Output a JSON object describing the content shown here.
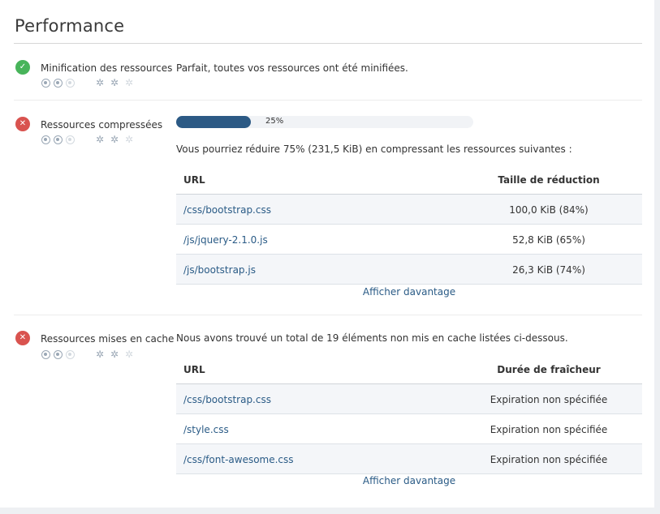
{
  "title": "Performance",
  "colors": {
    "ok": "#48b45a",
    "bad": "#d9534f",
    "progress": "#2c5a85",
    "link": "#2a5b86"
  },
  "rules": [
    {
      "name": "Minification des ressources",
      "status": "ok",
      "status_icon": "check-icon",
      "description": "Parfait, toutes vos ressources ont été minifiées."
    },
    {
      "name": "Ressources compressées",
      "status": "bad",
      "status_icon": "cross-icon",
      "progress": {
        "percent": 25,
        "label": "25%"
      },
      "description": "Vous pourriez réduire 75% (231,5 KiB) en compressant les ressources suivantes :",
      "table": {
        "col_url": "URL",
        "col_value": "Taille de réduction",
        "rows": [
          {
            "url": "/css/bootstrap.css",
            "value": "100,0 KiB (84%)"
          },
          {
            "url": "/js/jquery-2.1.0.js",
            "value": "52,8 KiB (65%)"
          },
          {
            "url": "/js/bootstrap.js",
            "value": "26,3 KiB (74%)"
          }
        ]
      },
      "more_label": "Afficher davantage"
    },
    {
      "name": "Ressources mises en cache",
      "status": "bad",
      "status_icon": "cross-icon",
      "description": "Nous avons trouvé un total de 19 éléments non mis en cache listées ci-dessous.",
      "table": {
        "col_url": "URL",
        "col_value": "Durée de fraîcheur",
        "rows": [
          {
            "url": "/css/bootstrap.css",
            "value": "Expiration non spécifiée"
          },
          {
            "url": "/style.css",
            "value": "Expiration non spécifiée"
          },
          {
            "url": "/css/font-awesome.css",
            "value": "Expiration non spécifiée"
          }
        ]
      },
      "more_label": "Afficher davantage"
    }
  ]
}
